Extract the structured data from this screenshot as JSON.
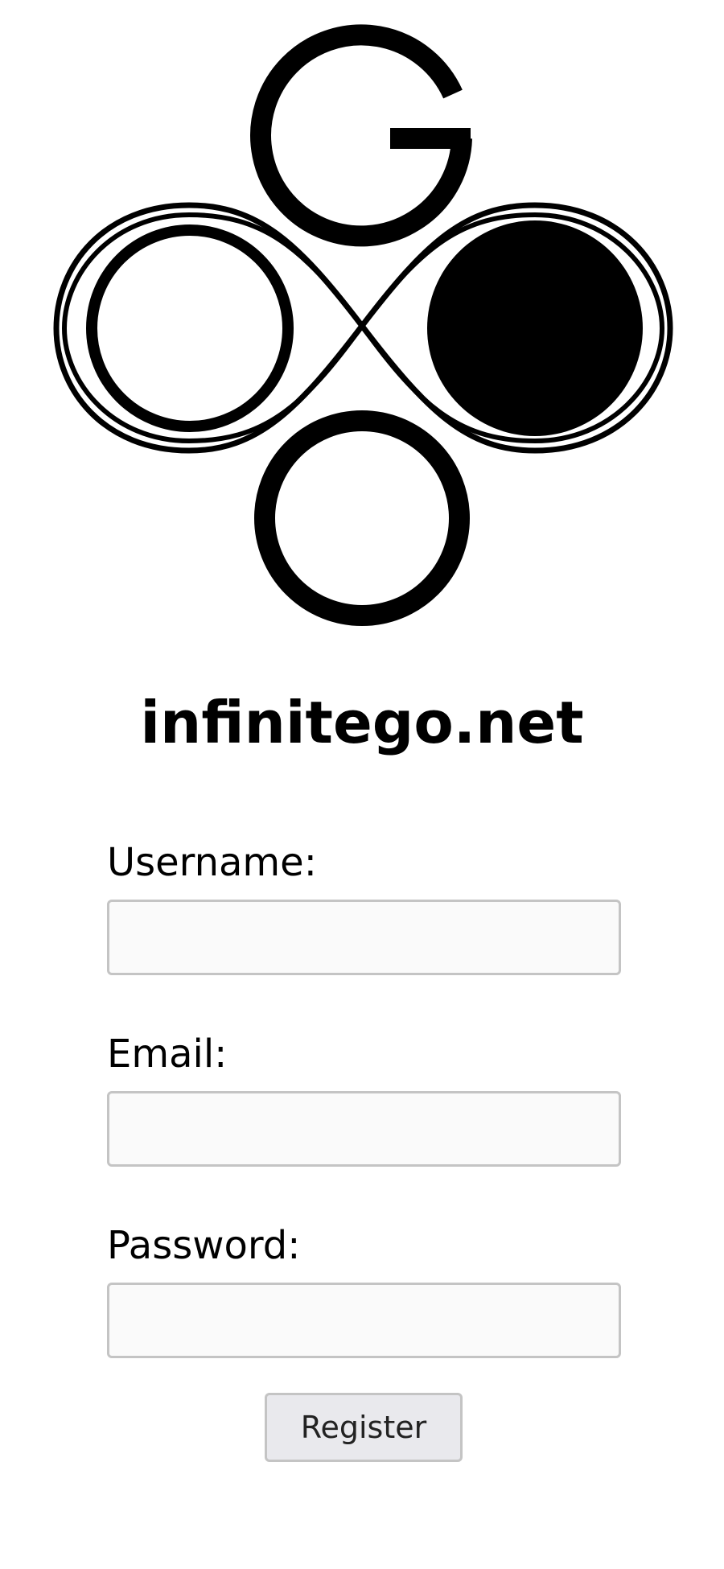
{
  "logo": {
    "icon": "infinitego-logo-icon"
  },
  "site": {
    "title": "infinitego.net"
  },
  "form": {
    "username_label": "Username:",
    "username_value": "",
    "email_label": "Email:",
    "email_value": "",
    "password_label": "Password:",
    "password_value": "",
    "register_label": "Register"
  },
  "colors": {
    "foreground": "#000000",
    "background": "#ffffff",
    "input_border": "#c4c4c4",
    "input_background": "#fafafa",
    "button_background": "#e9e9ed"
  }
}
